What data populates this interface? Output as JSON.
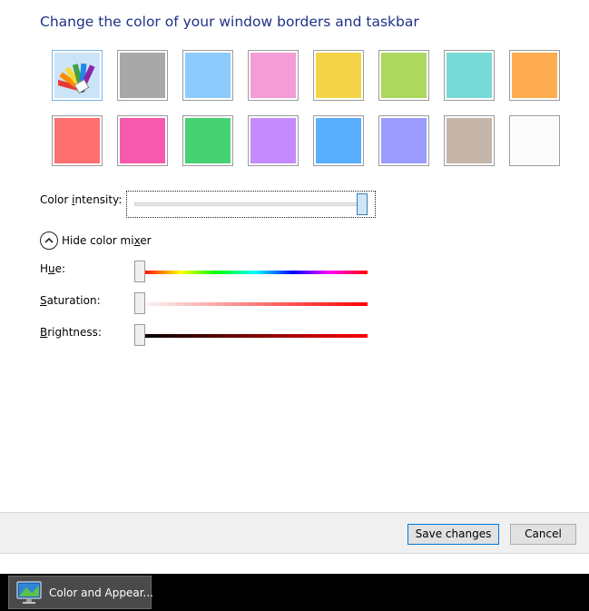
{
  "title": "Change the color of your window borders and taskbar",
  "swatches": {
    "row1": [
      "#d0d0d0",
      "#a8a8a8",
      "#8ecbfd",
      "#f49cd6",
      "#f3d447",
      "#add85f",
      "#78dad8",
      "#feac4f"
    ],
    "row2": [
      "#fe6f70",
      "#f659ae",
      "#46d172",
      "#c48bfe",
      "#59aefe",
      "#9c9bfe",
      "#c5b6a9",
      "#fbfbfb"
    ],
    "selected_icon": "color-palette-fan-icon"
  },
  "intensity": {
    "label_pre": "Color ",
    "label_key": "i",
    "label_post": "ntensity:",
    "value": 1.0
  },
  "mixer": {
    "toggle_label_pre": "Hide color mi",
    "toggle_label_key": "x",
    "toggle_label_post": "er",
    "toggle_icon": "chevron-up-icon",
    "hue": {
      "pre": "H",
      "key": "u",
      "post": "e:",
      "value": 0.0
    },
    "saturation": {
      "pre": "",
      "key": "S",
      "post": "aturation:",
      "value": 0.0
    },
    "brightness": {
      "pre": "",
      "key": "B",
      "post": "rightness:",
      "value": 0.0
    }
  },
  "buttons": {
    "save": "Save changes",
    "cancel": "Cancel"
  },
  "taskbar": {
    "item_label": "Color and Appear...",
    "item_icon": "monitor-personalization-icon"
  }
}
